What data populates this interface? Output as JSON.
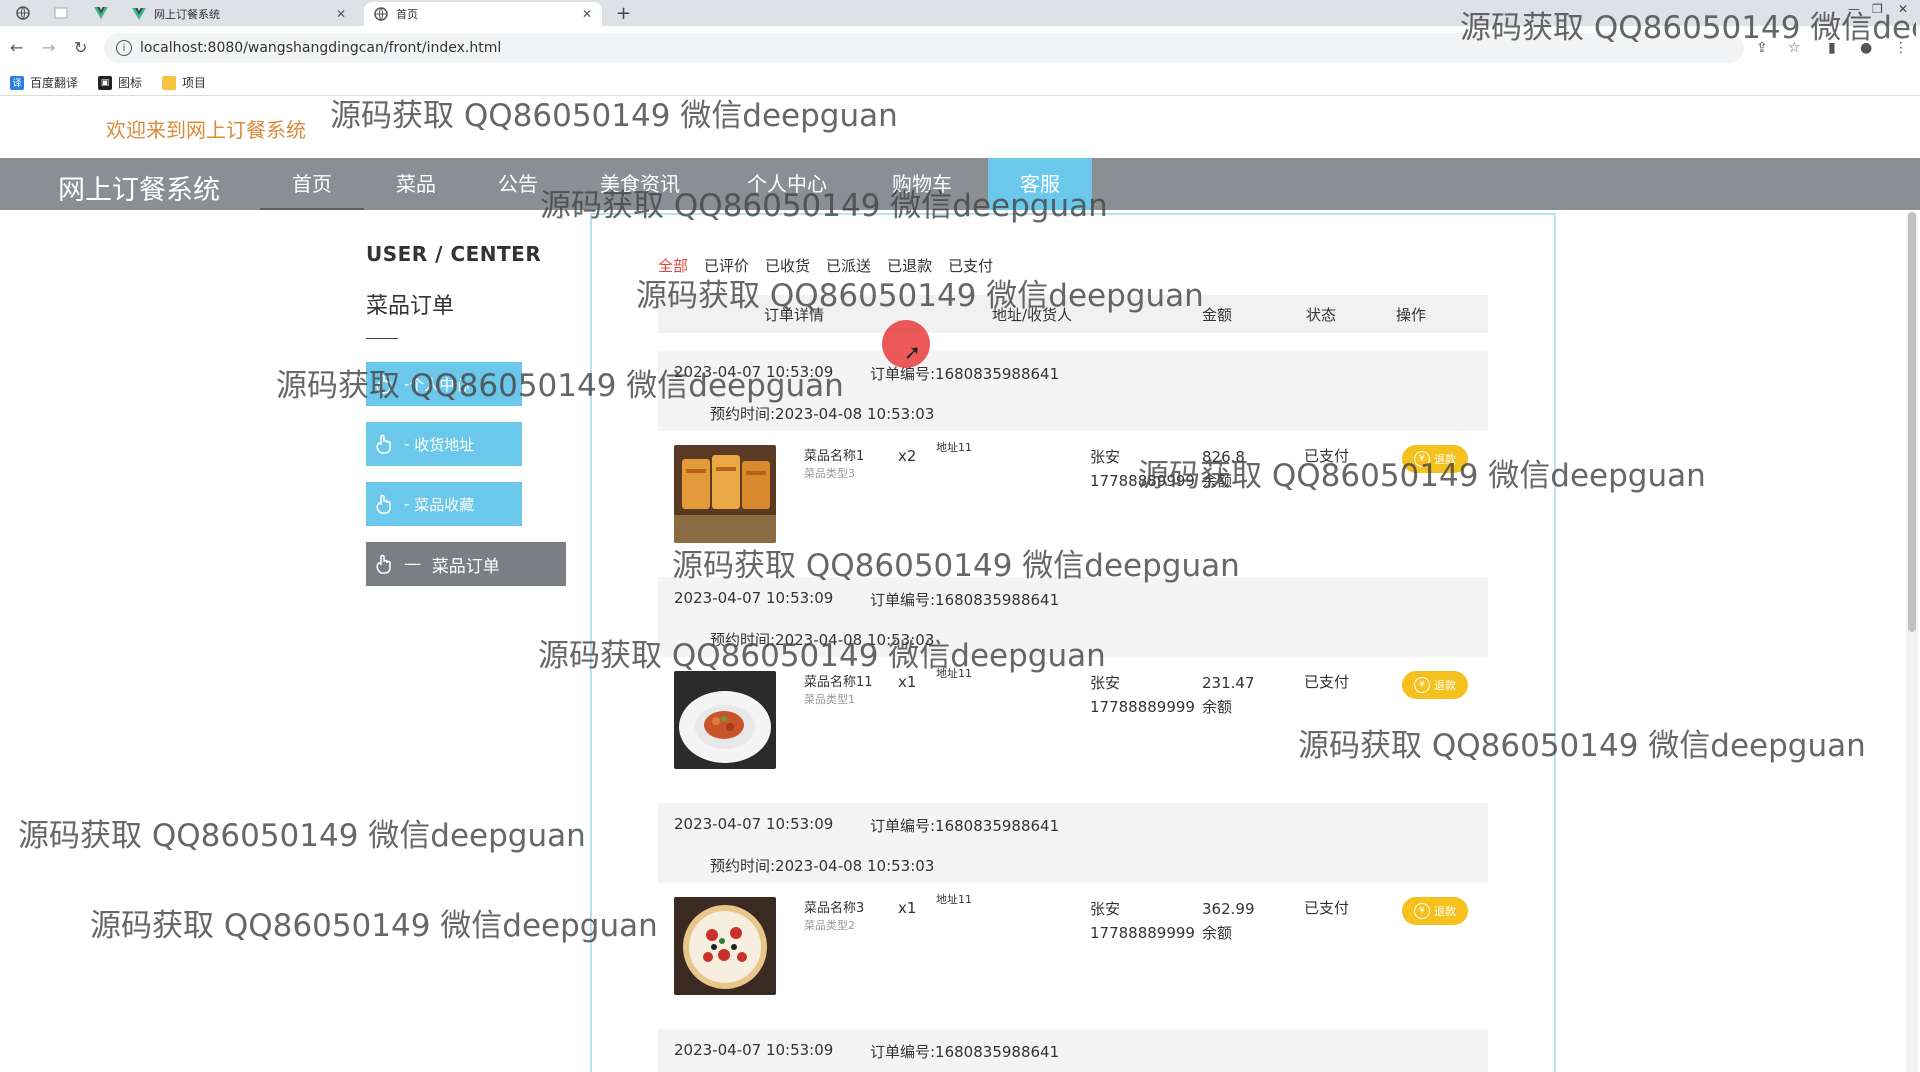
{
  "browser": {
    "tabs": [
      {
        "title": "网上订餐系统",
        "active": false,
        "icon": "vue-icon"
      },
      {
        "title": "首页",
        "active": true,
        "icon": "globe-icon"
      }
    ],
    "url": "localhost:8080/wangshangdingcan/front/index.html",
    "bookmarks": [
      {
        "label": "百度翻译",
        "icon": "translate-icon"
      },
      {
        "label": "图标",
        "icon": "image-icon"
      },
      {
        "label": "项目",
        "icon": "folder-icon"
      }
    ]
  },
  "site": {
    "welcome": "欢迎来到网上订餐系统",
    "title": "网上订餐系统",
    "nav": [
      "首页",
      "菜品",
      "公告",
      "美食资讯",
      "个人中心",
      "购物车",
      "客服"
    ],
    "active_nav": "客服",
    "colors": {
      "accent": "#6cc8ea",
      "navbar": "#8a8f94",
      "welcome": "#d98c3b",
      "refund": "#f5c11e",
      "active_filter": "#e0463a"
    }
  },
  "sidebar": {
    "title": "USER / CENTER",
    "subtitle": "菜品订单",
    "items": [
      {
        "label": "个人中心",
        "active": false
      },
      {
        "label": "收货地址",
        "active": false
      },
      {
        "label": "菜品收藏",
        "active": false
      },
      {
        "label": "菜品订单",
        "active": true
      }
    ]
  },
  "orders_panel": {
    "filters": [
      "全部",
      "已评价",
      "已收货",
      "已派送",
      "已退款",
      "已支付"
    ],
    "active_filter": "全部",
    "columns": [
      "订单详情",
      "地址/收货人",
      "金额",
      "状态",
      "操作"
    ],
    "orders": [
      {
        "date": "2023-04-07 10:53:09",
        "order_no": "订单编号:1680835988641",
        "reserve": "预约时间:2023-04-08 10:53:03",
        "dish": "菜品名称1",
        "type": "菜品类型3",
        "qty": "x2",
        "address": "地址11",
        "person": "张安",
        "phone": "17788889999",
        "amount": "826.8",
        "pay": "余额",
        "status": "已支付",
        "action": "退款",
        "image": "fried-snack-photo"
      },
      {
        "date": "2023-04-07 10:53:09",
        "order_no": "订单编号:1680835988641",
        "reserve": "预约时间:2023-04-08 10:53:03",
        "dish": "菜品名称11",
        "type": "菜品类型1",
        "qty": "x1",
        "address": "地址11",
        "person": "张安",
        "phone": "17788889999",
        "amount": "231.47",
        "pay": "余额",
        "status": "已支付",
        "action": "退款",
        "image": "plated-dish-photo"
      },
      {
        "date": "2023-04-07 10:53:09",
        "order_no": "订单编号:1680835988641",
        "reserve": "预约时间:2023-04-08 10:53:03",
        "dish": "菜品名称3",
        "type": "菜品类型2",
        "qty": "x1",
        "address": "地址11",
        "person": "张安",
        "phone": "17788889999",
        "amount": "362.99",
        "pay": "余额",
        "status": "已支付",
        "action": "退款",
        "image": "pizza-photo"
      },
      {
        "date": "2023-04-07 10:53:09",
        "order_no": "订单编号:1680835988641"
      }
    ]
  },
  "watermark": "源码获取 QQ86050149 微信deepguan"
}
